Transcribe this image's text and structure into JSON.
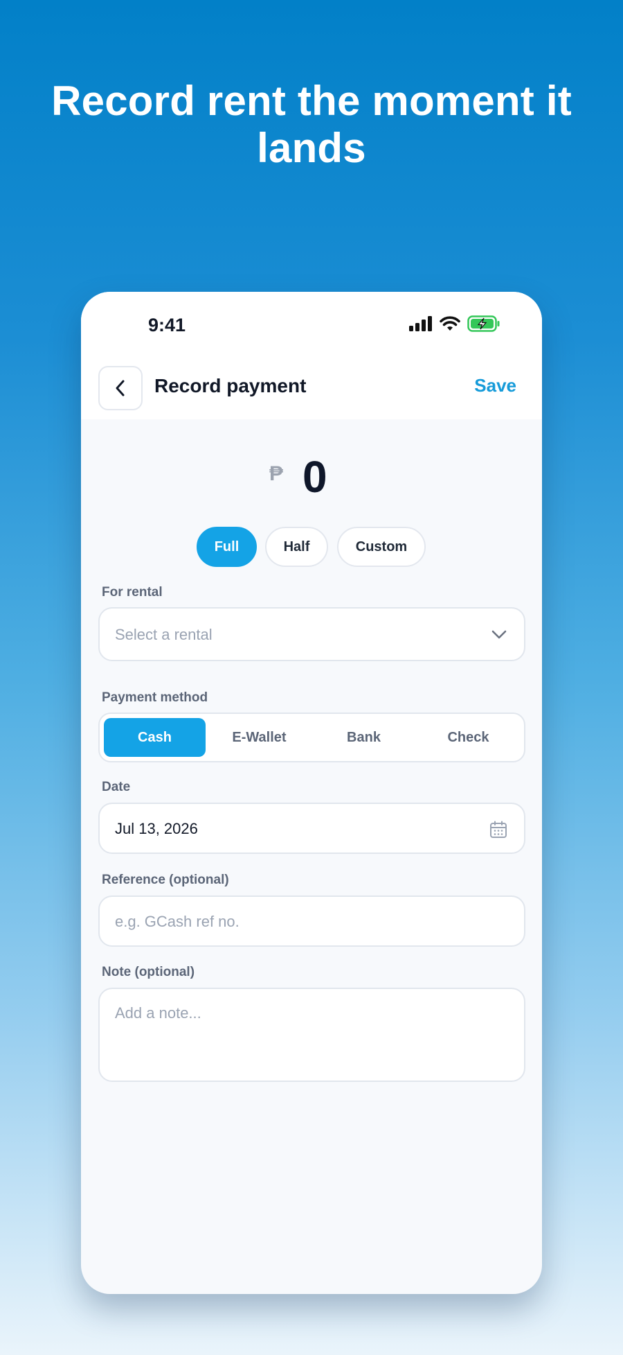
{
  "headline": "Record rent the moment it lands",
  "status": {
    "time": "9:41"
  },
  "nav": {
    "title": "Record payment",
    "save_label": "Save"
  },
  "amount": {
    "currency": "₱",
    "value": "0"
  },
  "presets": [
    {
      "label": "Full",
      "active": true
    },
    {
      "label": "Half",
      "active": false
    },
    {
      "label": "Custom",
      "active": false
    }
  ],
  "rental": {
    "label": "For rental",
    "placeholder": "Select a rental"
  },
  "payment_method": {
    "label": "Payment method",
    "options": [
      {
        "label": "Cash",
        "active": true
      },
      {
        "label": "E-Wallet",
        "active": false
      },
      {
        "label": "Bank",
        "active": false
      },
      {
        "label": "Check",
        "active": false
      }
    ]
  },
  "date": {
    "label": "Date",
    "value": "Jul 13, 2026"
  },
  "reference": {
    "label": "Reference (optional)",
    "placeholder": "e.g. GCash ref no."
  },
  "note": {
    "label": "Note (optional)",
    "placeholder": "Add a note..."
  },
  "colors": {
    "accent": "#14a3e6",
    "save": "#169bd9",
    "battery": "#34c759"
  },
  "icons": [
    "signal-icon",
    "wifi-icon",
    "battery-charging-icon",
    "chevron-left-icon",
    "chevron-down-icon",
    "calendar-icon"
  ]
}
